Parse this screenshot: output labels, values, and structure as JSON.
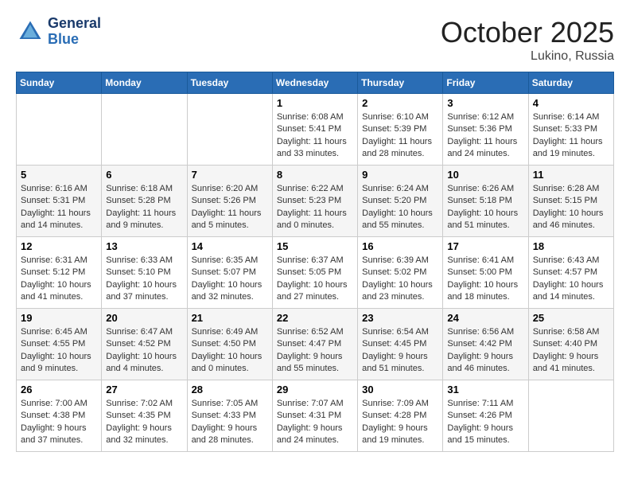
{
  "header": {
    "logo_line1": "General",
    "logo_line2": "Blue",
    "month": "October 2025",
    "location": "Lukino, Russia"
  },
  "weekdays": [
    "Sunday",
    "Monday",
    "Tuesday",
    "Wednesday",
    "Thursday",
    "Friday",
    "Saturday"
  ],
  "weeks": [
    [
      {
        "day": "",
        "info": ""
      },
      {
        "day": "",
        "info": ""
      },
      {
        "day": "",
        "info": ""
      },
      {
        "day": "1",
        "info": "Sunrise: 6:08 AM\nSunset: 5:41 PM\nDaylight: 11 hours\nand 33 minutes."
      },
      {
        "day": "2",
        "info": "Sunrise: 6:10 AM\nSunset: 5:39 PM\nDaylight: 11 hours\nand 28 minutes."
      },
      {
        "day": "3",
        "info": "Sunrise: 6:12 AM\nSunset: 5:36 PM\nDaylight: 11 hours\nand 24 minutes."
      },
      {
        "day": "4",
        "info": "Sunrise: 6:14 AM\nSunset: 5:33 PM\nDaylight: 11 hours\nand 19 minutes."
      }
    ],
    [
      {
        "day": "5",
        "info": "Sunrise: 6:16 AM\nSunset: 5:31 PM\nDaylight: 11 hours\nand 14 minutes."
      },
      {
        "day": "6",
        "info": "Sunrise: 6:18 AM\nSunset: 5:28 PM\nDaylight: 11 hours\nand 9 minutes."
      },
      {
        "day": "7",
        "info": "Sunrise: 6:20 AM\nSunset: 5:26 PM\nDaylight: 11 hours\nand 5 minutes."
      },
      {
        "day": "8",
        "info": "Sunrise: 6:22 AM\nSunset: 5:23 PM\nDaylight: 11 hours\nand 0 minutes."
      },
      {
        "day": "9",
        "info": "Sunrise: 6:24 AM\nSunset: 5:20 PM\nDaylight: 10 hours\nand 55 minutes."
      },
      {
        "day": "10",
        "info": "Sunrise: 6:26 AM\nSunset: 5:18 PM\nDaylight: 10 hours\nand 51 minutes."
      },
      {
        "day": "11",
        "info": "Sunrise: 6:28 AM\nSunset: 5:15 PM\nDaylight: 10 hours\nand 46 minutes."
      }
    ],
    [
      {
        "day": "12",
        "info": "Sunrise: 6:31 AM\nSunset: 5:12 PM\nDaylight: 10 hours\nand 41 minutes."
      },
      {
        "day": "13",
        "info": "Sunrise: 6:33 AM\nSunset: 5:10 PM\nDaylight: 10 hours\nand 37 minutes."
      },
      {
        "day": "14",
        "info": "Sunrise: 6:35 AM\nSunset: 5:07 PM\nDaylight: 10 hours\nand 32 minutes."
      },
      {
        "day": "15",
        "info": "Sunrise: 6:37 AM\nSunset: 5:05 PM\nDaylight: 10 hours\nand 27 minutes."
      },
      {
        "day": "16",
        "info": "Sunrise: 6:39 AM\nSunset: 5:02 PM\nDaylight: 10 hours\nand 23 minutes."
      },
      {
        "day": "17",
        "info": "Sunrise: 6:41 AM\nSunset: 5:00 PM\nDaylight: 10 hours\nand 18 minutes."
      },
      {
        "day": "18",
        "info": "Sunrise: 6:43 AM\nSunset: 4:57 PM\nDaylight: 10 hours\nand 14 minutes."
      }
    ],
    [
      {
        "day": "19",
        "info": "Sunrise: 6:45 AM\nSunset: 4:55 PM\nDaylight: 10 hours\nand 9 minutes."
      },
      {
        "day": "20",
        "info": "Sunrise: 6:47 AM\nSunset: 4:52 PM\nDaylight: 10 hours\nand 4 minutes."
      },
      {
        "day": "21",
        "info": "Sunrise: 6:49 AM\nSunset: 4:50 PM\nDaylight: 10 hours\nand 0 minutes."
      },
      {
        "day": "22",
        "info": "Sunrise: 6:52 AM\nSunset: 4:47 PM\nDaylight: 9 hours\nand 55 minutes."
      },
      {
        "day": "23",
        "info": "Sunrise: 6:54 AM\nSunset: 4:45 PM\nDaylight: 9 hours\nand 51 minutes."
      },
      {
        "day": "24",
        "info": "Sunrise: 6:56 AM\nSunset: 4:42 PM\nDaylight: 9 hours\nand 46 minutes."
      },
      {
        "day": "25",
        "info": "Sunrise: 6:58 AM\nSunset: 4:40 PM\nDaylight: 9 hours\nand 41 minutes."
      }
    ],
    [
      {
        "day": "26",
        "info": "Sunrise: 7:00 AM\nSunset: 4:38 PM\nDaylight: 9 hours\nand 37 minutes."
      },
      {
        "day": "27",
        "info": "Sunrise: 7:02 AM\nSunset: 4:35 PM\nDaylight: 9 hours\nand 32 minutes."
      },
      {
        "day": "28",
        "info": "Sunrise: 7:05 AM\nSunset: 4:33 PM\nDaylight: 9 hours\nand 28 minutes."
      },
      {
        "day": "29",
        "info": "Sunrise: 7:07 AM\nSunset: 4:31 PM\nDaylight: 9 hours\nand 24 minutes."
      },
      {
        "day": "30",
        "info": "Sunrise: 7:09 AM\nSunset: 4:28 PM\nDaylight: 9 hours\nand 19 minutes."
      },
      {
        "day": "31",
        "info": "Sunrise: 7:11 AM\nSunset: 4:26 PM\nDaylight: 9 hours\nand 15 minutes."
      },
      {
        "day": "",
        "info": ""
      }
    ]
  ]
}
